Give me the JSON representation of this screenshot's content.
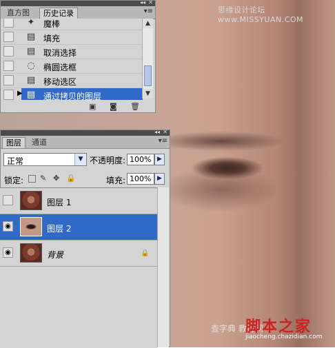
{
  "watermarks": {
    "top": "思缘设计论坛 www.MISSYUAN.COM",
    "bottom_big": "脚本之家",
    "bottom_mid": "查字典 教程网",
    "bottom_small": "jiaocheng.chazidian.com"
  },
  "history_panel": {
    "tabs": [
      "直方图",
      "历史记录"
    ],
    "active_tab": "历史记录",
    "items": [
      {
        "label": "魔棒",
        "icon": "magic-wand-icon",
        "glyph": "✦"
      },
      {
        "label": "填充",
        "icon": "history-state-icon",
        "glyph": "▤"
      },
      {
        "label": "取消选择",
        "icon": "history-state-icon",
        "glyph": "▤"
      },
      {
        "label": "椭圆选框",
        "icon": "ellipse-marquee-icon",
        "glyph": "◌"
      },
      {
        "label": "移动选区",
        "icon": "history-state-icon",
        "glyph": "▤"
      },
      {
        "label": "通过拷贝的图层",
        "icon": "history-state-icon",
        "glyph": "▤",
        "selected": true
      }
    ],
    "footer_icons": [
      "new-document-icon",
      "snapshot-icon",
      "trash-icon"
    ]
  },
  "layers_panel": {
    "tabs": [
      "图层",
      "通道"
    ],
    "active_tab": "图层",
    "blend_mode": "正常",
    "opacity_label": "不透明度:",
    "opacity_value": "100%",
    "lock_label": "锁定:",
    "fill_label": "填充:",
    "fill_value": "100%",
    "layers": [
      {
        "name": "图层 1",
        "visible": false,
        "selected": false
      },
      {
        "name": "图层 2",
        "visible": true,
        "selected": true
      },
      {
        "name": "背景",
        "visible": true,
        "selected": false,
        "locked": true
      }
    ]
  },
  "colors": {
    "selection": "#3169c6",
    "panel_bg": "#d4d4d4",
    "tab_bar": "#b8b8b8",
    "titlebar": "#4b4b4b"
  }
}
